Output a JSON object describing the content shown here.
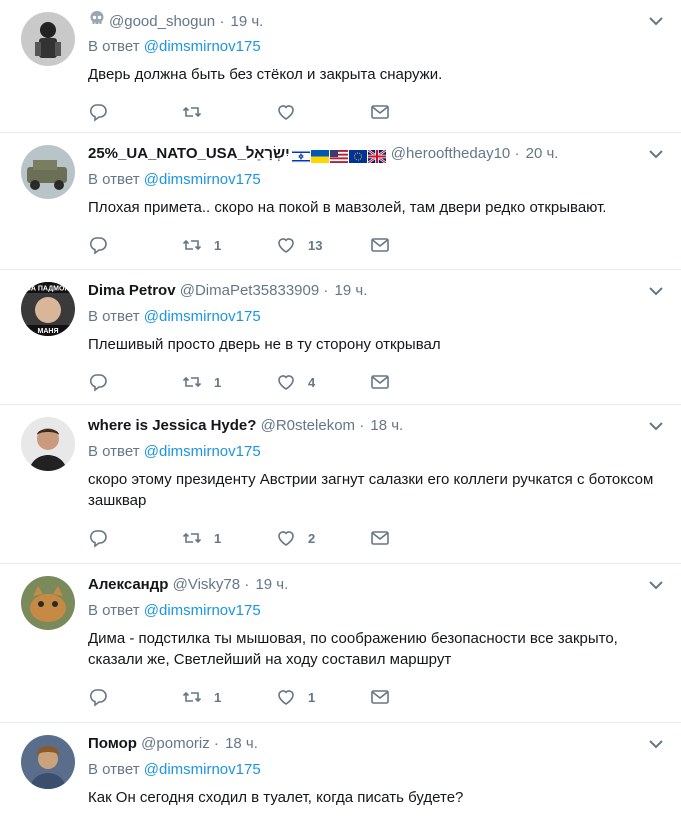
{
  "reply_prefix": "В ответ",
  "tweets": [
    {
      "fullname": "",
      "username": "@good_shogun",
      "dot": "·",
      "time": "19 ч.",
      "mention": "@dimsmirnov175",
      "text": "Дверь должна быть без стёкол и закрыта снаружи.",
      "retweets": "",
      "likes": ""
    },
    {
      "fullname": "25%_UA_NATO_USA_יִשְׂרָאֵל",
      "username": "@herooftheday10",
      "dot": "·",
      "time": "20 ч.",
      "mention": "@dimsmirnov175",
      "text": "Плохая примета.. скоро на покой в мавзолей, там двери редко открывают.",
      "retweets": "1",
      "likes": "13"
    },
    {
      "fullname": "Dima Petrov",
      "username": "@DimaPet35833909",
      "dot": "·",
      "time": "19 ч.",
      "mention": "@dimsmirnov175",
      "text": "Плешивый просто дверь не в ту сторону открывал",
      "retweets": "1",
      "likes": "4"
    },
    {
      "fullname": "where is Jessica Hyde?",
      "username": "@R0stelekom",
      "dot": "·",
      "time": "18 ч.",
      "mention": "@dimsmirnov175",
      "text": "скоро этому президенту Австрии загнут салазки его коллеги ручкатся с ботоксом зашквар",
      "retweets": "1",
      "likes": "2"
    },
    {
      "fullname": "Александр",
      "username": "@Visky78",
      "dot": "·",
      "time": "19 ч.",
      "mention": "@dimsmirnov175",
      "text": "Дима - подстилка ты мышовая, по соображению безопасности все закрыто, сказали же, Светлейший на ходу составил маршрут",
      "retweets": "1",
      "likes": "1"
    },
    {
      "fullname": "Помор",
      "username": "@pomoriz",
      "dot": "·",
      "time": "18 ч.",
      "mention": "@dimsmirnov175",
      "text": "Как Он сегодня сходил в туалет, когда писать будете?",
      "retweets": "",
      "likes": ""
    }
  ],
  "avatar_text": {
    "dima_petrov_top": "ЗА ПАДМОН",
    "dima_petrov_bottom": "МАНЯ"
  },
  "icons": {
    "reply": "reply-icon",
    "retweet": "retweet-icon",
    "like": "heart-icon",
    "dm": "envelope-icon",
    "caret": "chevron-down-icon",
    "skull": "skull-icon"
  },
  "flags": [
    "israel-flag",
    "ukraine-flag",
    "usa-flag",
    "eu-flag",
    "uk-flag"
  ],
  "colors": {
    "mention": "#1b95e0",
    "meta": "#657786",
    "divider": "#e6ecf0",
    "text": "#14171a"
  }
}
